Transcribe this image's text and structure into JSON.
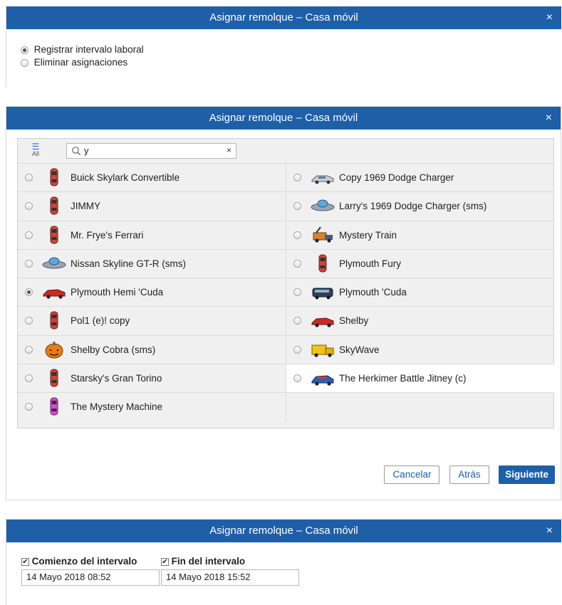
{
  "dialog1": {
    "title": "Asignar remolque – Casa móvil",
    "close": "×",
    "options": [
      {
        "label": "Registrar intervalo laboral",
        "selected": true
      },
      {
        "label": "Eliminar asignaciones",
        "selected": false
      }
    ]
  },
  "dialog2": {
    "title": "Asignar remolque – Casa móvil",
    "close": "×",
    "all_label": "All",
    "search": {
      "value": "y",
      "clear": "×"
    },
    "units_left": [
      {
        "name": "Buick Skylark Convertible",
        "icon": "red-car-top-icon",
        "selected": false
      },
      {
        "name": "JIMMY",
        "icon": "red-car-top-icon",
        "selected": false
      },
      {
        "name": "Mr. Frye's Ferrari",
        "icon": "red-car-top-icon",
        "selected": false
      },
      {
        "name": "Nissan Skyline GT-R (sms)",
        "icon": "ufo-icon",
        "selected": false
      },
      {
        "name": "Plymouth Hemi 'Cuda",
        "icon": "red-sports-car-icon",
        "selected": true
      },
      {
        "name": "Pol1 (e)! copy",
        "icon": "red-car-top-icon",
        "selected": false
      },
      {
        "name": "Shelby Cobra (sms)",
        "icon": "pumpkin-icon",
        "selected": false
      },
      {
        "name": "Starsky's Gran Torino",
        "icon": "red-car-top-icon",
        "selected": false
      },
      {
        "name": "The Mystery Machine",
        "icon": "pink-car-top-icon",
        "selected": false
      }
    ],
    "units_right": [
      {
        "name": "Copy 1969 Dodge Charger",
        "icon": "silver-car-icon",
        "selected": false
      },
      {
        "name": "Larry's 1969 Dodge Charger (sms)",
        "icon": "ufo-icon",
        "selected": false
      },
      {
        "name": "Mystery Train",
        "icon": "tow-truck-icon",
        "selected": false
      },
      {
        "name": "Plymouth Fury",
        "icon": "red-car-top-icon",
        "selected": false
      },
      {
        "name": "Plymouth 'Cuda",
        "icon": "bus-icon",
        "selected": false
      },
      {
        "name": "Shelby",
        "icon": "red-sports-car-icon",
        "selected": false
      },
      {
        "name": "SkyWave",
        "icon": "yellow-truck-icon",
        "selected": false
      },
      {
        "name": "The Herkimer Battle Jitney (c)",
        "icon": "blue-red-car-icon",
        "selected": false
      }
    ],
    "buttons": {
      "cancel": "Cancelar",
      "back": "Atrás",
      "next": "Siguiente"
    }
  },
  "dialog3": {
    "title": "Asignar remolque – Casa móvil",
    "close": "×",
    "start": {
      "label": "Comienzo del intervalo",
      "checked": true,
      "value": "14 Mayo 2018 08:52"
    },
    "end": {
      "label": "Fin del intervalo",
      "checked": true,
      "value": "14 Mayo 2018 15:52"
    }
  },
  "colors": {
    "titlebar": "#1e5fa8",
    "panel": "#f0f0f0",
    "accent": "#1e5fa8"
  }
}
